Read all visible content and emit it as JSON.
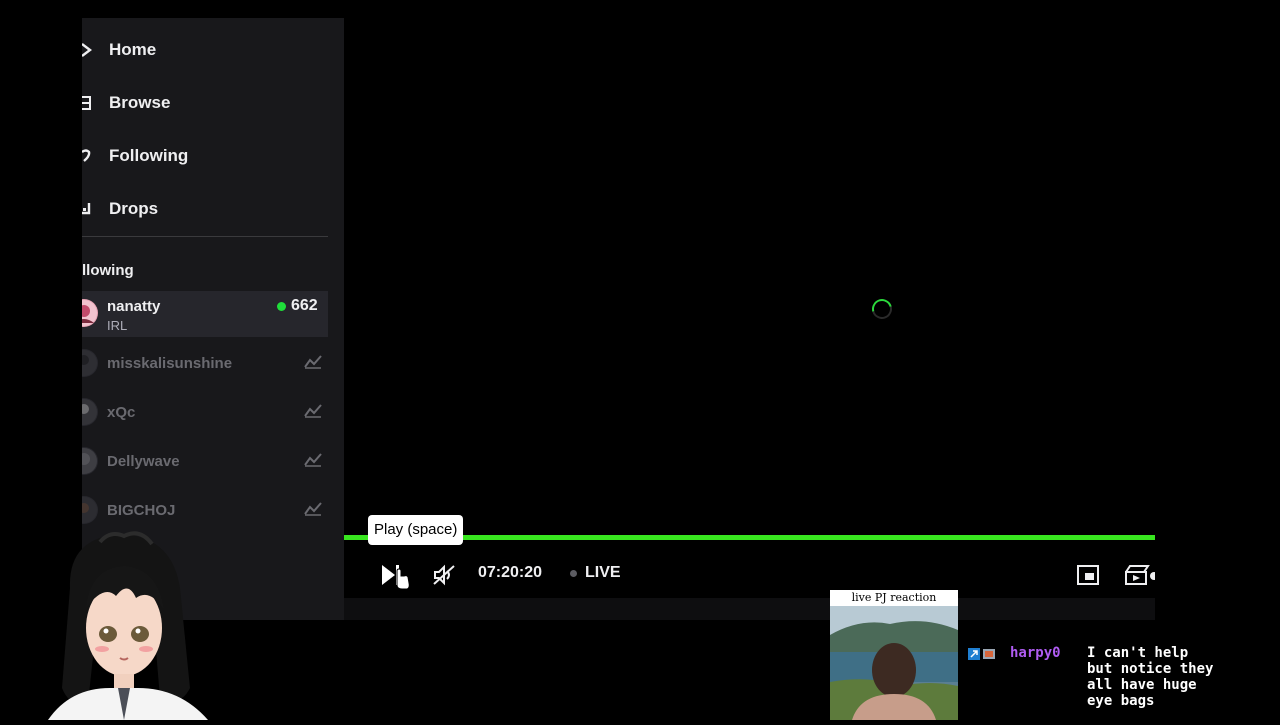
{
  "nav": [
    {
      "label": "Home",
      "icon": "home-icon"
    },
    {
      "label": "Browse",
      "icon": "browse-icon"
    },
    {
      "label": "Following",
      "icon": "heart-icon"
    },
    {
      "label": "Drops",
      "icon": "drops-icon"
    }
  ],
  "following": {
    "title": "llowing",
    "channels": [
      {
        "name": "nanatty",
        "category": "IRL",
        "viewers": "662",
        "live": true
      },
      {
        "name": "misskalisunshine",
        "live": false
      },
      {
        "name": "xQc",
        "live": false
      },
      {
        "name": "Dellywave",
        "live": false
      },
      {
        "name": "BIGCHOJ",
        "live": false
      }
    ],
    "cut_label": "l"
  },
  "player": {
    "tooltip": "Play (space)",
    "time": "07:20:20",
    "live_label": "LIVE",
    "progress": 1.0,
    "accent": "#38e61f"
  },
  "overlay": {
    "cam_title": "live PJ reaction"
  },
  "chat": {
    "username": "harpy0",
    "message": "I can't help\nbut notice they\nall have huge\neye bags",
    "username_color": "#b05cf2"
  }
}
